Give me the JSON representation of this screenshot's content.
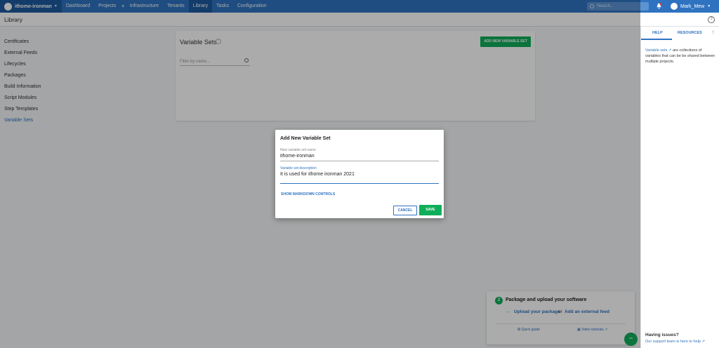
{
  "topnav": {
    "space": "ithome-ironman",
    "links": [
      "Dashboard",
      "Projects",
      "Infrastructure",
      "Tenants",
      "Library",
      "Tasks",
      "Configuration"
    ],
    "search_placeholder": "Search...",
    "user": "Mark_Mew"
  },
  "subheader": {
    "title": "Library"
  },
  "sidebar": {
    "items": [
      "Certificates",
      "External Feeds",
      "Lifecycles",
      "Packages",
      "Build Information",
      "Script Modules",
      "Step Templates",
      "Variable Sets"
    ]
  },
  "main": {
    "title": "Variable Sets",
    "add_button": "ADD NEW VARIABLE SET",
    "filter_placeholder": "Filter by name..."
  },
  "right_panel": {
    "tab_help": "HELP",
    "tab_resources": "RESOURCES",
    "help_link": "Variable sets",
    "help_text": " are collections of variables that can be be shared between multiple projects.",
    "issues_title": "Having issues?",
    "support_text": "Our support team is here to help"
  },
  "onboarding": {
    "step": "2",
    "title": "Package and upload your software",
    "upload_link": "Upload your package",
    "or_text": "or",
    "external_link": "Add an external feed",
    "quick_guide": "Quick guide",
    "video_tutorials": "Video tutorials"
  },
  "dialog": {
    "title": "Add New Variable Set",
    "name_label": "New variable set name",
    "name_value": "ithome-ironman",
    "desc_label": "Variable set description",
    "desc_value": "It is used for ithome ironman 2021",
    "markdown_label": "SHOW MARKDOWN CONTROLS",
    "cancel": "CANCEL",
    "save": "SAVE"
  },
  "colors": {
    "accent": "#2f73c0",
    "green": "#0fae5a",
    "nav_dark": "#1d5a9e"
  }
}
